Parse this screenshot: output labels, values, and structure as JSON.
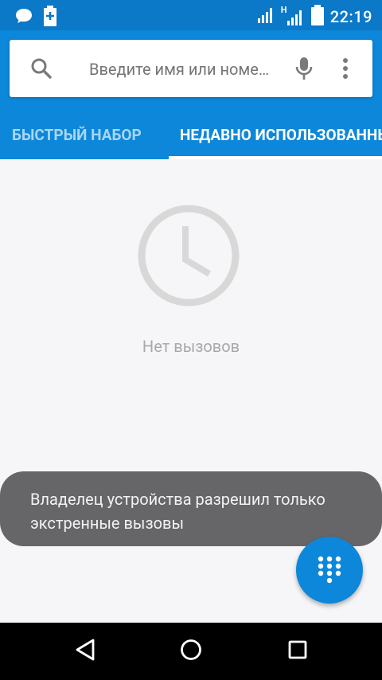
{
  "status_bar": {
    "time": "22:19",
    "network_label": "H",
    "icons": [
      "message-icon",
      "battery-charging-icon",
      "signal-icon",
      "signal-h-icon",
      "battery-icon"
    ]
  },
  "search": {
    "placeholder": "Введите имя или номе…",
    "icons": [
      "search-icon",
      "mic-icon",
      "more-vert-icon"
    ]
  },
  "tabs": [
    {
      "label": "БЫСТРЫЙ НАБОР",
      "selected": false
    },
    {
      "label": "НЕДАВНО ИСПОЛЬЗОВАННЫЕ",
      "selected": true
    }
  ],
  "empty_state": {
    "icon": "clock-icon",
    "text": "Нет вызовов"
  },
  "toast": {
    "text": "Владелец устройства разрешил только экстренные вызовы"
  },
  "fab": {
    "icon": "dialpad-icon"
  },
  "navbar": {
    "icons": [
      "back-icon",
      "home-icon",
      "recents-icon"
    ]
  },
  "colors": {
    "status_bar": "#0b78c8",
    "header": "#0d87d9",
    "background": "#f6f6f8",
    "toast": "#666668",
    "empty_text": "#a8a8a8"
  }
}
